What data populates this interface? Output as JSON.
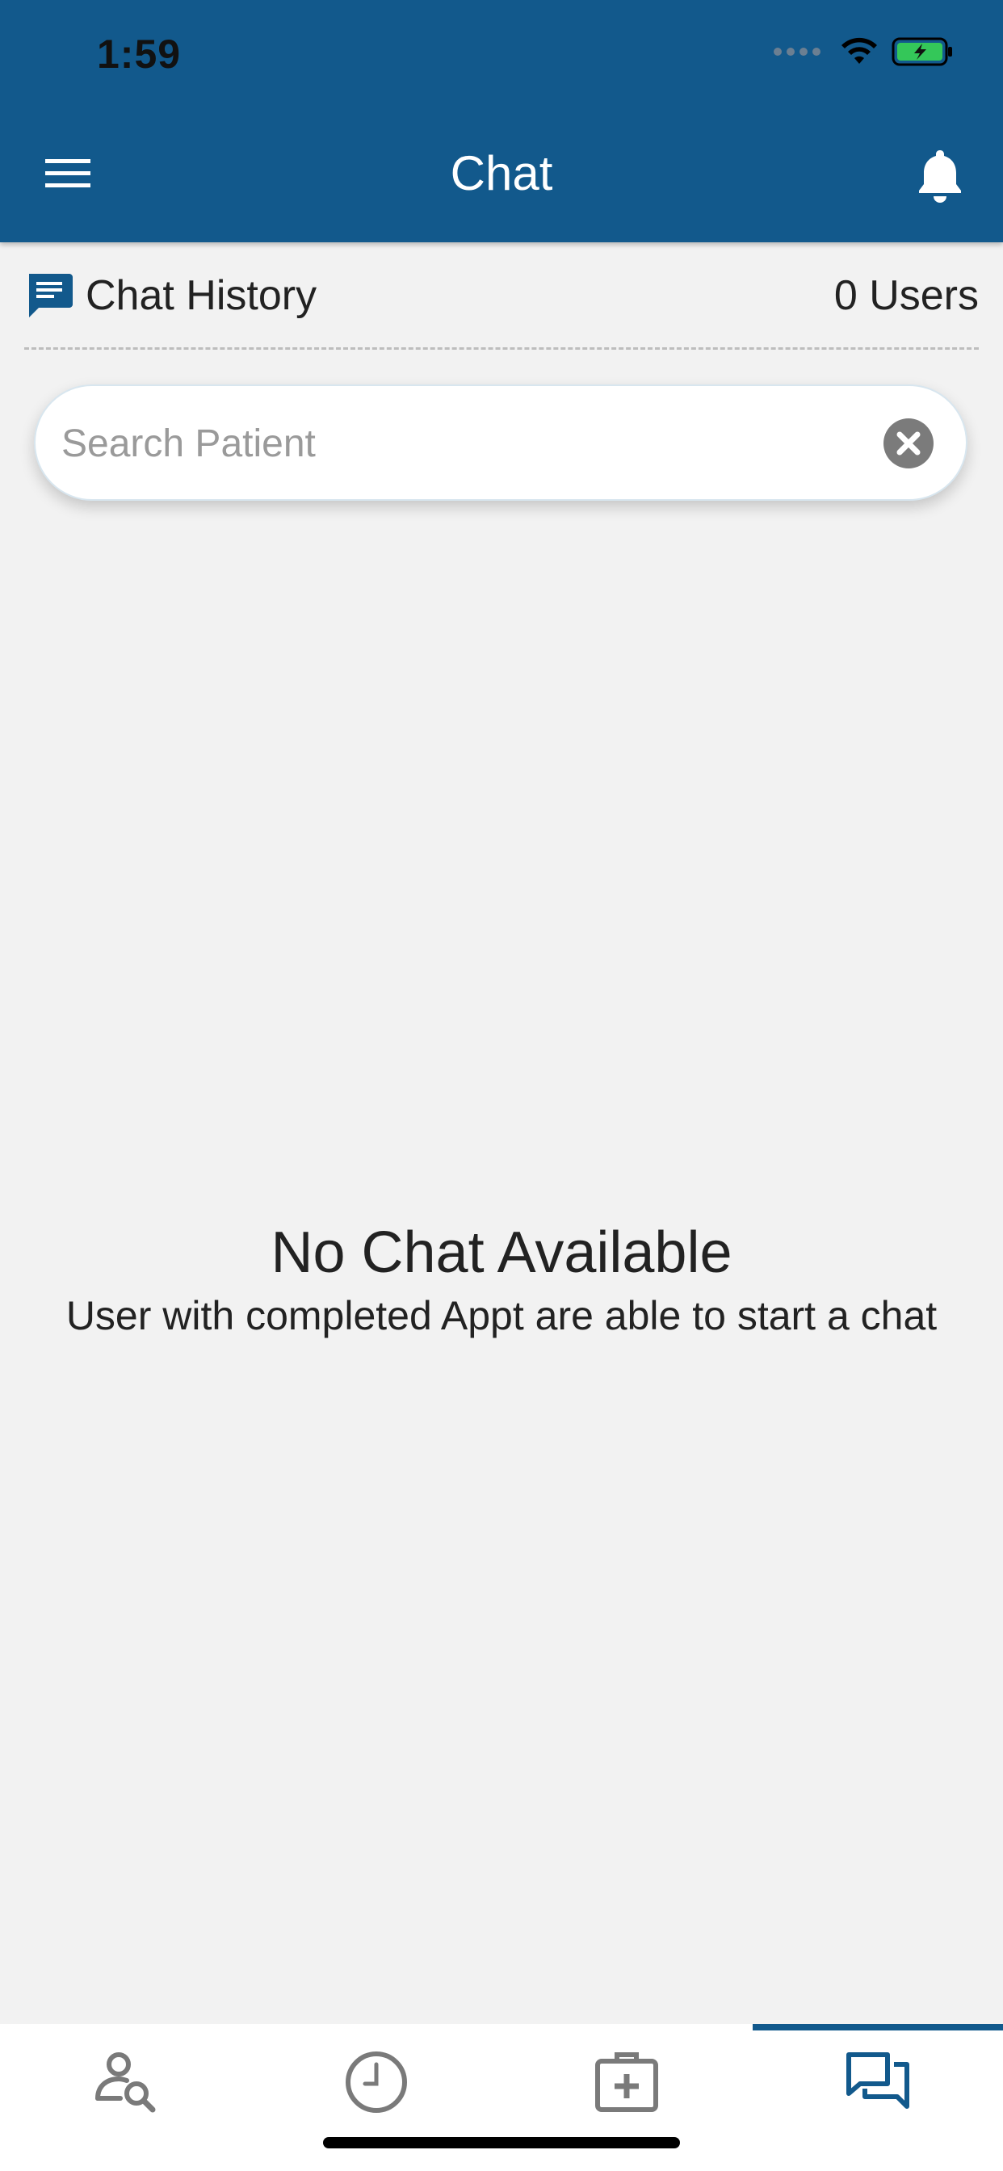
{
  "status_bar": {
    "time": "1:59"
  },
  "header": {
    "title": "Chat",
    "accent_color": "#12598c"
  },
  "chat_history": {
    "title": "Chat History",
    "users_count": "0 Users"
  },
  "search": {
    "placeholder": "Search Patient",
    "value": ""
  },
  "empty_state": {
    "title": "No Chat Available",
    "message": "User with completed Appt are able to start a chat"
  },
  "bottom_nav": {
    "items": [
      {
        "icon": "patient-search-icon",
        "active": false
      },
      {
        "icon": "clock-icon",
        "active": false
      },
      {
        "icon": "medical-kit-icon",
        "active": false
      },
      {
        "icon": "chat-icon",
        "active": true
      }
    ]
  }
}
